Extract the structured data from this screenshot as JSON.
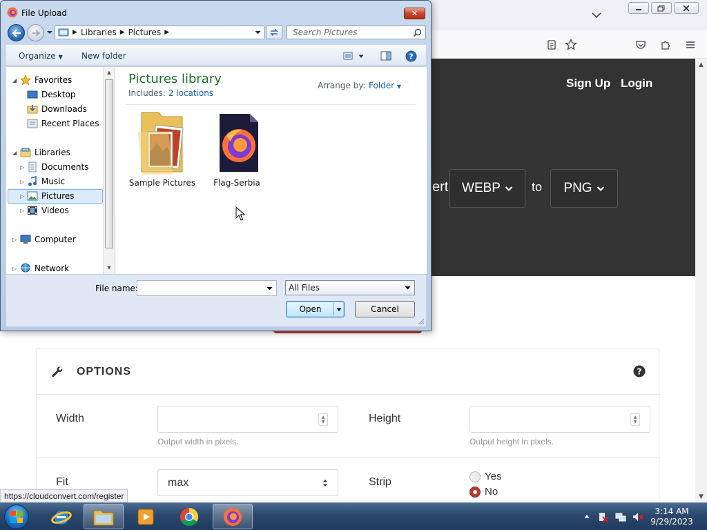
{
  "dialog": {
    "title": "File Upload",
    "close_label": "✕",
    "breadcrumb": [
      "Libraries",
      "Pictures"
    ],
    "search_placeholder": "Search Pictures",
    "organize_label": "Organize",
    "new_folder_label": "New folder",
    "tree": {
      "favorites": "Favorites",
      "desktop": "Desktop",
      "downloads": "Downloads",
      "recent_places": "Recent Places",
      "libraries": "Libraries",
      "documents": "Documents",
      "music": "Music",
      "pictures": "Pictures",
      "videos": "Videos",
      "computer": "Computer",
      "network": "Network"
    },
    "library_title": "Pictures library",
    "includes_label": "Includes:",
    "includes_link": "2 locations",
    "arrange_label": "Arrange by:",
    "arrange_value": "Folder",
    "files": [
      "Sample Pictures",
      "Flag-Serbia"
    ],
    "file_name_label": "File name:",
    "file_name_value": "",
    "filter_value": "All Files",
    "open_label": "Open",
    "cancel_label": "Cancel"
  },
  "site": {
    "signup_label": "Sign Up",
    "login_label": "Login",
    "convert_fragment": "ert",
    "from_format": "WEBP",
    "to_text": "to",
    "to_format": "PNG",
    "options_title": "OPTIONS",
    "width_label": "Width",
    "width_help": "Output width in pixels.",
    "height_label": "Height",
    "height_help": "Output height in pixels.",
    "fit_label": "Fit",
    "fit_value": "max",
    "strip_label": "Strip",
    "strip_yes": "Yes",
    "strip_no": "No",
    "strip_selected": "No"
  },
  "status_bar": {
    "url": "https://cloudconvert.com/register"
  },
  "taskbar": {
    "time": "3:14 AM",
    "date": "9/29/2023"
  },
  "colors": {
    "site_header": "#333333",
    "accent_red": "#c0392b",
    "library_green": "#1f6f2c",
    "link_blue": "#1964b8"
  }
}
